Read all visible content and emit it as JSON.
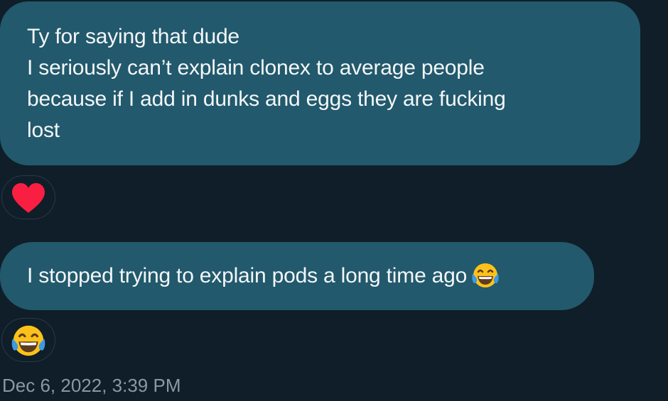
{
  "messages": [
    {
      "lines": [
        "Ty for saying that dude",
        "I seriously can’t explain clonex to average people",
        "because if I add in dunks and eggs they are fucking",
        "lost"
      ],
      "reaction": "heart-icon"
    },
    {
      "text": "I stopped trying to explain pods a long time ago",
      "inline_emoji": "face-with-tears-of-joy-icon",
      "reaction": "face-with-tears-of-joy-icon"
    }
  ],
  "timestamp": "Dec 6, 2022, 3:39 PM",
  "colors": {
    "background": "#0f1e28",
    "bubble": "#22596c",
    "heart": "#f91880",
    "timestamp": "#8899a6"
  }
}
